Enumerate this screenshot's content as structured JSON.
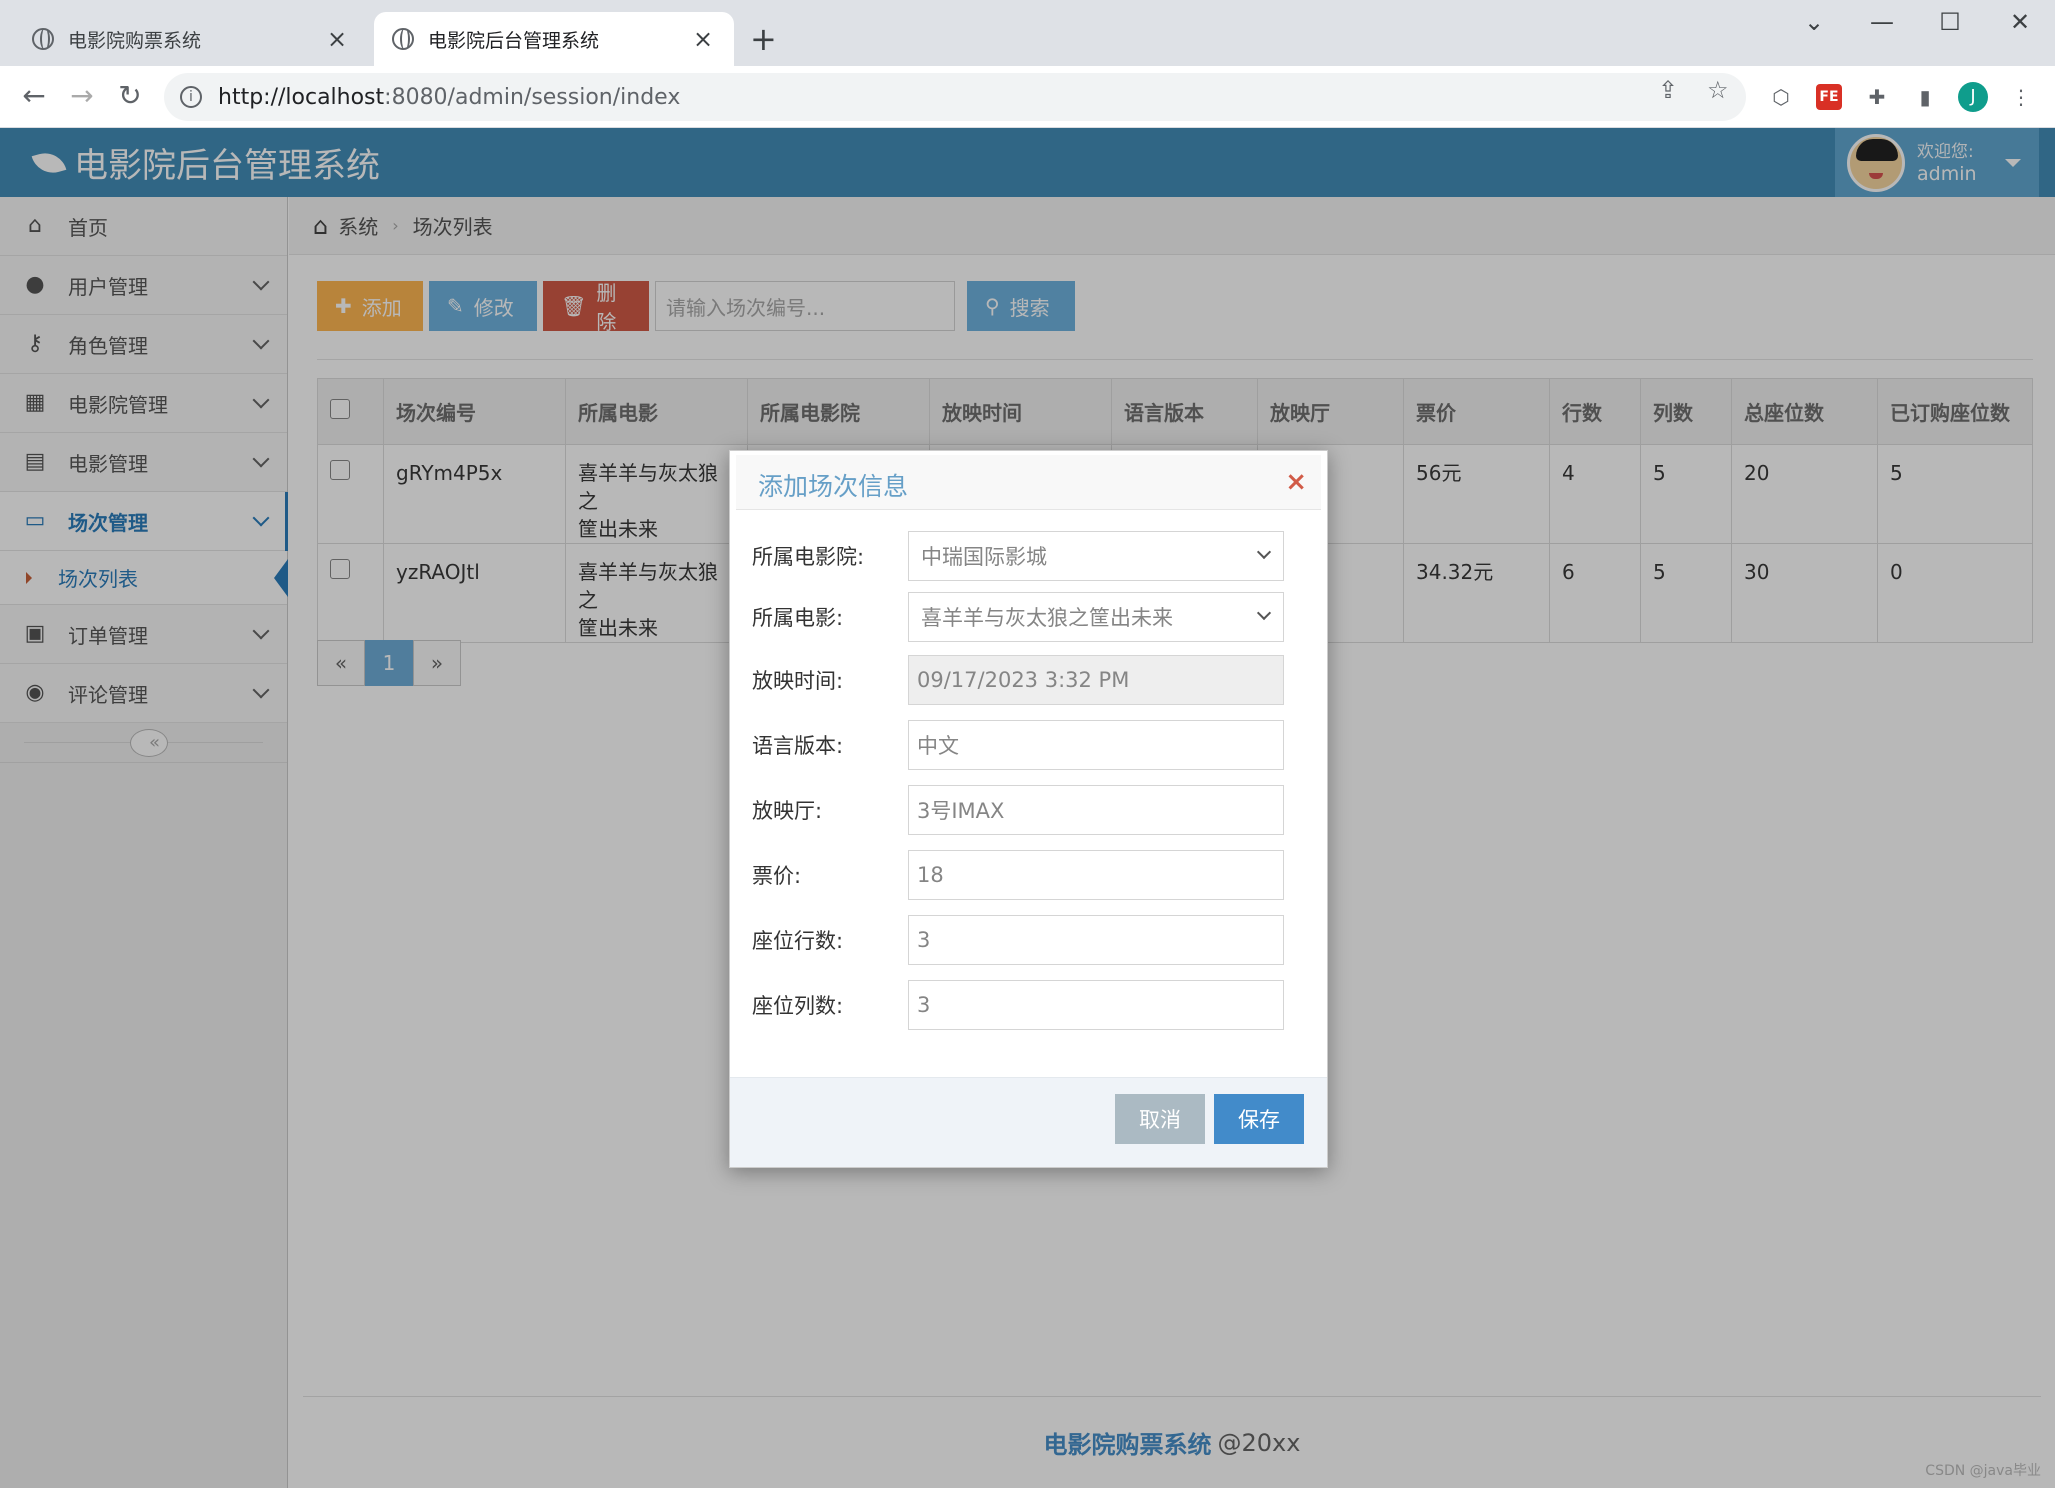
{
  "browser": {
    "tabs": [
      {
        "title": "电影院购票系统"
      },
      {
        "title": "电影院后台管理系统"
      }
    ],
    "url_host": "http://localhost",
    "url_rest": ":8080/admin/session/index"
  },
  "header": {
    "brand": "电影院后台管理系统",
    "welcome": "欢迎您:",
    "username": "admin"
  },
  "sidebar": {
    "items": [
      {
        "label": "首页",
        "icon": "home-icon"
      },
      {
        "label": "用户管理",
        "icon": "user-icon"
      },
      {
        "label": "角色管理",
        "icon": "key-icon"
      },
      {
        "label": "电影院管理",
        "icon": "building-icon"
      },
      {
        "label": "电影管理",
        "icon": "film-icon"
      },
      {
        "label": "场次管理",
        "icon": "desktop-icon"
      },
      {
        "label": "订单管理",
        "icon": "money-icon"
      },
      {
        "label": "评论管理",
        "icon": "comment-icon"
      }
    ],
    "subitem": "场次列表"
  },
  "breadcrumb": {
    "root": "系统",
    "current": "场次列表"
  },
  "toolbar": {
    "add": "添加",
    "edit": "修改",
    "delete": "删除",
    "search_placeholder": "请输入场次编号...",
    "search": "搜索"
  },
  "table": {
    "headers": [
      "场次编号",
      "所属电影",
      "所属电影院",
      "放映时间",
      "语言版本",
      "放映厅",
      "票价",
      "行数",
      "列数",
      "总座位数",
      "已订购座位数"
    ],
    "rows": [
      {
        "id": "gRYm4P5x",
        "movie_l1": "喜羊羊与灰太狼之",
        "movie_l2": "筐出未来",
        "price": "56元",
        "rows": "4",
        "cols": "5",
        "total": "20",
        "booked": "5"
      },
      {
        "id": "yzRAOJtl",
        "movie_l1": "喜羊羊与灰太狼之",
        "movie_l2": "筐出未来",
        "price": "34.32元",
        "rows": "6",
        "cols": "5",
        "total": "30",
        "booked": "0"
      }
    ]
  },
  "pagination": {
    "prev": "«",
    "current": "1",
    "next": "»"
  },
  "footer": {
    "brand": "电影院购票系统",
    "suffix": "@20xx"
  },
  "modal": {
    "title": "添加场次信息",
    "close": "×",
    "fields": [
      {
        "label": "所属电影院:",
        "value": "中瑞国际影城"
      },
      {
        "label": "所属电影:",
        "value": "喜羊羊与灰太狼之筐出未来"
      },
      {
        "label": "放映时间:",
        "value": "09/17/2023 3:32 PM"
      },
      {
        "label": "语言版本:",
        "value": "中文"
      },
      {
        "label": "放映厅:",
        "value": "3号IMAX"
      },
      {
        "label": "票价:",
        "value": "18"
      },
      {
        "label": "座位行数:",
        "value": "3"
      },
      {
        "label": "座位列数:",
        "value": "3"
      }
    ],
    "cancel": "取消",
    "save": "保存"
  },
  "watermark": "CSDN @java毕业"
}
